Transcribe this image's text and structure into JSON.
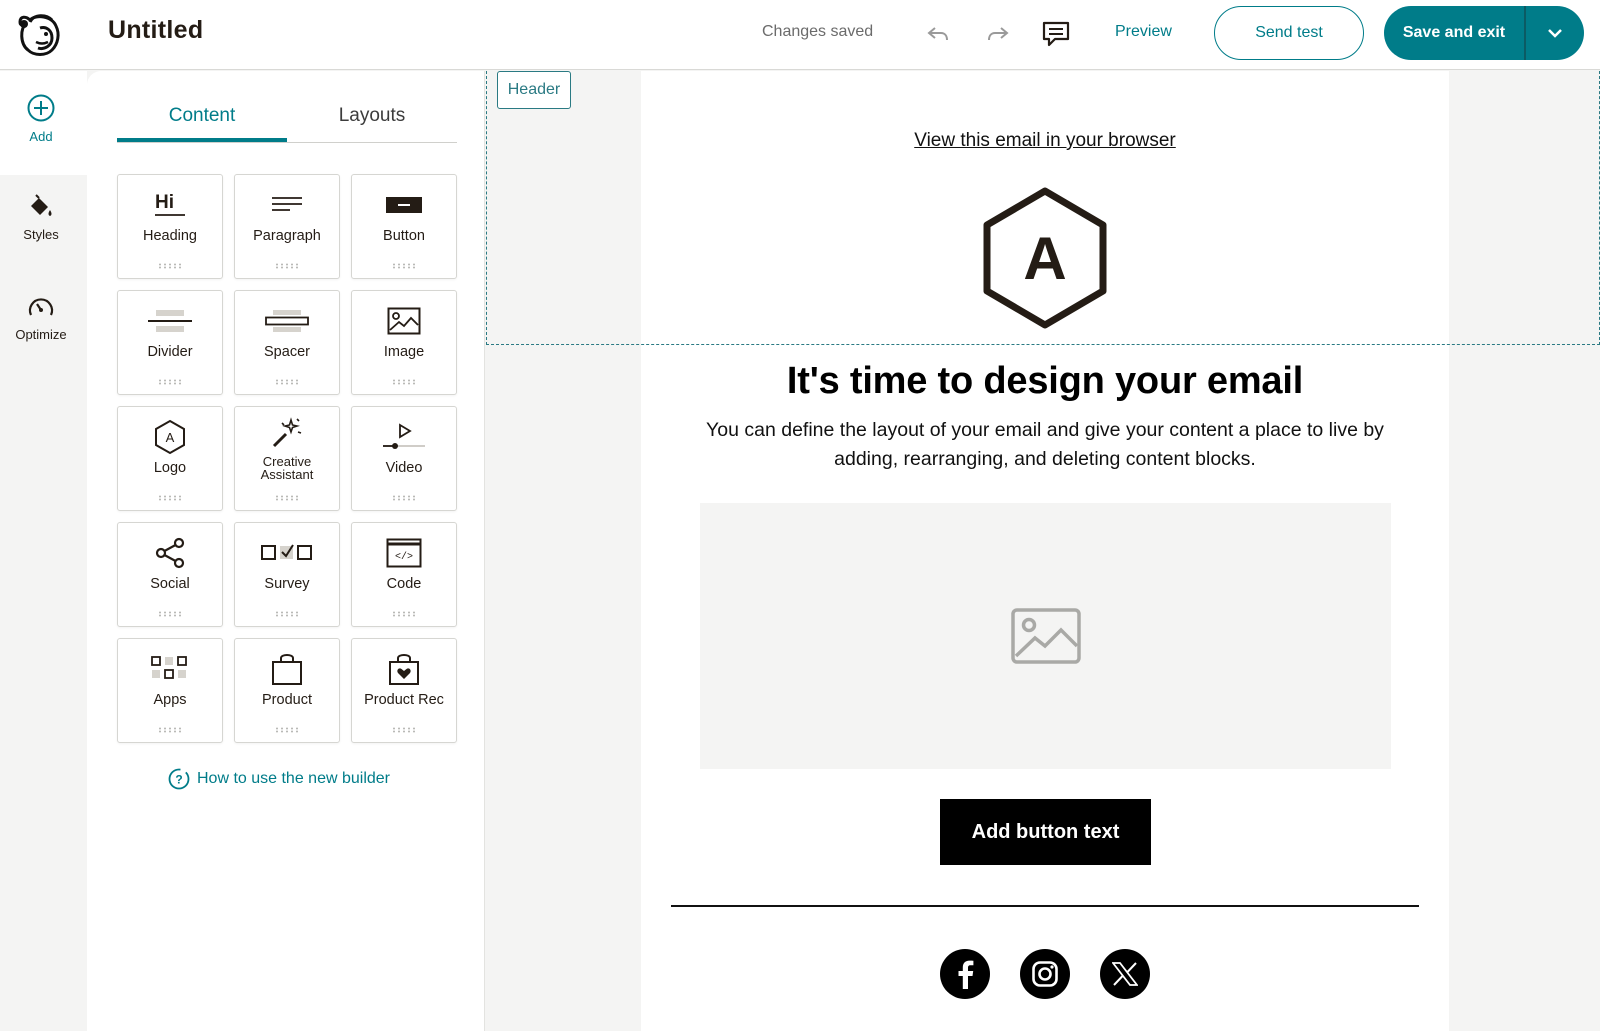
{
  "app": {
    "title": "Untitled",
    "status": "Changes saved"
  },
  "toolbar": {
    "undo_icon": "undo-icon",
    "redo_icon": "redo-icon",
    "comment_icon": "comment-icon",
    "preview_label": "Preview",
    "send_test_label": "Send test",
    "save_exit_label": "Save and exit"
  },
  "rail": {
    "items": [
      {
        "label": "Add",
        "icon": "plus-circle-icon"
      },
      {
        "label": "Styles",
        "icon": "paint-bucket-icon"
      },
      {
        "label": "Optimize",
        "icon": "gauge-icon"
      }
    ]
  },
  "panel": {
    "tabs": [
      {
        "label": "Content"
      },
      {
        "label": "Layouts"
      }
    ],
    "active_tab": "Content",
    "blocks": [
      {
        "label": "Heading"
      },
      {
        "label": "Paragraph"
      },
      {
        "label": "Button"
      },
      {
        "label": "Divider"
      },
      {
        "label": "Spacer"
      },
      {
        "label": "Image"
      },
      {
        "label": "Logo"
      },
      {
        "label": "Creative Assistant"
      },
      {
        "label": "Video"
      },
      {
        "label": "Social"
      },
      {
        "label": "Survey"
      },
      {
        "label": "Code"
      },
      {
        "label": "Apps"
      },
      {
        "label": "Product"
      },
      {
        "label": "Product Rec"
      }
    ],
    "help_link": "How to use the new builder"
  },
  "email": {
    "section_tag": "Header",
    "view_in_browser": "View this email in your browser",
    "logo_letter": "A",
    "headline": "It's time to design your email",
    "body": "You can define the layout of your email and give your content a place to live by adding, rearranging, and deleting content blocks.",
    "button_label": "Add button text",
    "social_icons": [
      "facebook-icon",
      "instagram-icon",
      "x-icon"
    ]
  },
  "colors": {
    "accent": "#007c89",
    "text": "#241c15",
    "canvas": "#f4f4f3"
  }
}
